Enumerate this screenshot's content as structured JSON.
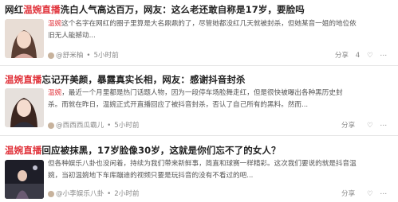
{
  "items": [
    {
      "title_prefix": "网红",
      "title_highlight": "温婉直播",
      "title_suffix": "洗白人气高达百万，网友：这么老还敢自称是17岁，要脸吗",
      "body_lines": [
        {
          "hl": "温婉",
          "text": "这个名字在网红的圈子里算是大名鼎鼎的了，尽管她都没红几天就被封杀，但她某音一姐的地位依"
        },
        {
          "hl": "",
          "text": "旧无人能撼动..."
        }
      ],
      "author": "@舒米柚",
      "time": "5小时前",
      "share_label": "分享",
      "share_count": "4",
      "like_count": ""
    },
    {
      "title_prefix": "",
      "title_highlight": "温婉直播",
      "title_suffix": "忘记开美颜，暴露真实长相，网友：感谢抖音封杀",
      "body_lines": [
        {
          "hl": "温婉",
          "text": "，最近一个月里都是热门话题人物，因为一段停车场脸舞走红，但是很快被曝出各种黑历史封"
        },
        {
          "hl": "",
          "text": "杀。而就在昨日，温婉正式开直播回应了被抖音封杀，否认了自己所有的黑料。然而..."
        }
      ],
      "author": "@西西西瓜霸儿",
      "time": "5小时前",
      "share_label": "分享",
      "share_count": "",
      "like_count": ""
    },
    {
      "title_prefix": "",
      "title_highlight": "温婉直播",
      "title_suffix": "回应被抹黑，17岁脸像30岁，这就是你们忘不了的女人？",
      "body_lines": [
        {
          "hl": "",
          "text": "但各种娱乐八卦也没闲着，持续为我们带来新鲜事，简直和球赛一样精彩。这次我们要说的就是抖音温"
        },
        {
          "hl": "",
          "text": "婉，当初温婉地下车库蹦迪的视频只要是玩抖音的没有不看过的吧..."
        }
      ],
      "author": "@小李娱乐八卦",
      "time": "2小时前",
      "share_label": "分享",
      "share_count": "",
      "like_count": ""
    }
  ]
}
